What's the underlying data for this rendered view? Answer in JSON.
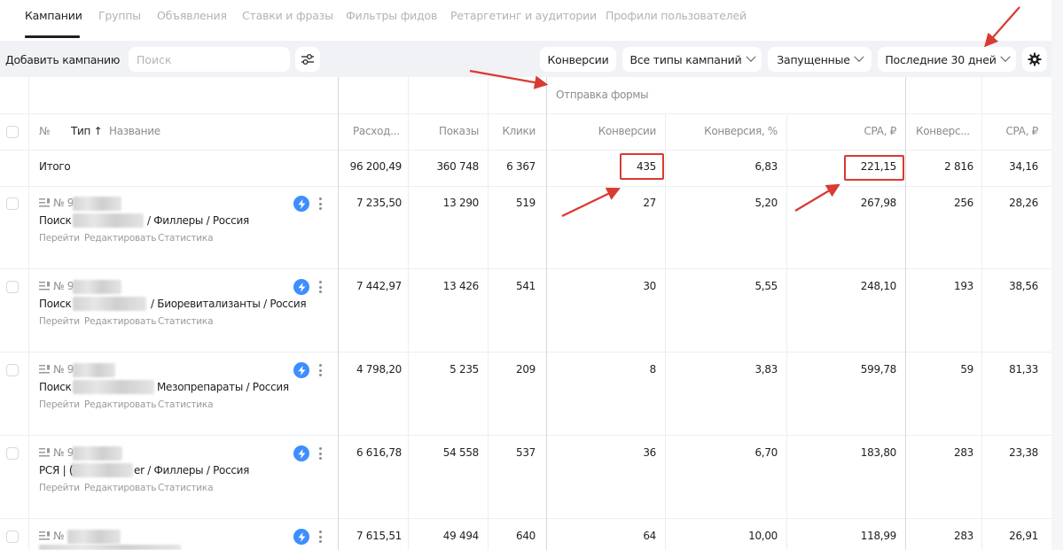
{
  "tabs": [
    {
      "label": "Кампании",
      "active": true
    },
    {
      "label": "Группы"
    },
    {
      "label": "Объявления"
    },
    {
      "label": "Ставки и фразы"
    },
    {
      "label": "Фильтры фидов"
    },
    {
      "label": "Ретаргетинг и аудитории"
    },
    {
      "label": "Профили пользователей"
    }
  ],
  "toolbar": {
    "add_campaign": "Добавить кампанию",
    "search_placeholder": "Поиск",
    "conversions": "Конверсии",
    "campaign_types": "Все типы кампаний",
    "status": "Запущенные",
    "period": "Последние 30 дней"
  },
  "table": {
    "group_header": "Отправка формы",
    "headers": {
      "no": "№",
      "type": "Тип ↑",
      "name": "Название",
      "spend": "Расход...",
      "impressions": "Показы",
      "clicks": "Клики",
      "conversions": "Конверсии",
      "conv_rate": "Конверсия, %",
      "cpa": "CPA, ₽",
      "conversions2": "Конверс...",
      "cpa2": "CPA, ₽"
    },
    "total": {
      "label": "Итого",
      "spend": "96 200,49",
      "impressions": "360 748",
      "clicks": "6 367",
      "conversions": "435",
      "conv_rate": "6,83",
      "cpa": "221,15",
      "conversions2": "2 816",
      "cpa2": "34,16"
    },
    "rows": [
      {
        "number": "№ 9",
        "name_prefix": "Поиск",
        "name_suffix": "/ Филлеры / Россия",
        "spend": "7 235,50",
        "impressions": "13 290",
        "clicks": "519",
        "conversions": "27",
        "conv_rate": "5,20",
        "cpa": "267,98",
        "conversions2": "256",
        "cpa2": "28,26"
      },
      {
        "number": "№ 9",
        "name_prefix": "Поиск",
        "name_suffix": "/ Биоревитализанты / Россия",
        "spend": "7 442,97",
        "impressions": "13 426",
        "clicks": "541",
        "conversions": "30",
        "conv_rate": "5,55",
        "cpa": "248,10",
        "conversions2": "193",
        "cpa2": "38,56"
      },
      {
        "number": "№ 9",
        "name_prefix": "Поиск",
        "name_suffix": "Мезопрепараты / Россия",
        "spend": "4 798,20",
        "impressions": "5 235",
        "clicks": "209",
        "conversions": "8",
        "conv_rate": "3,83",
        "cpa": "599,78",
        "conversions2": "59",
        "cpa2": "81,33"
      },
      {
        "number": "№ 9",
        "name_prefix": "РСЯ | (",
        "name_suffix": "er / Филлеры / Россия",
        "spend": "6 616,78",
        "impressions": "54 558",
        "clicks": "537",
        "conversions": "36",
        "conv_rate": "6,70",
        "cpa": "183,80",
        "conversions2": "283",
        "cpa2": "23,38"
      },
      {
        "number": "№",
        "name_prefix": "",
        "name_suffix": "",
        "spend": "7 615,51",
        "impressions": "49 494",
        "clicks": "640",
        "conversions": "64",
        "conv_rate": "10,00",
        "cpa": "118,99",
        "conversions2": "283",
        "cpa2": "26,91"
      }
    ],
    "row_links": {
      "go": "Перейти",
      "edit": "Редактировать",
      "stats": "Статистика"
    }
  },
  "colors": {
    "accent": "#3d8eff",
    "annotation": "#d93a32"
  }
}
